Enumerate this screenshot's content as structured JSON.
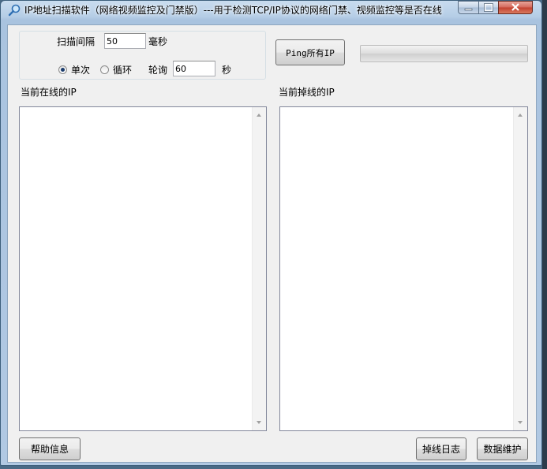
{
  "window": {
    "title": "IP地址扫描软件（网络视频监控及门禁版）---用于检测TCP/IP协议的网络门禁、视频监控等是否在线",
    "icon": "magnifier-icon"
  },
  "settings": {
    "scan_interval_label": "扫描间隔",
    "scan_interval_value": "50",
    "scan_interval_unit": "毫秒",
    "mode_single_label": "单次",
    "mode_loop_label": "循环",
    "mode_selected": "单次",
    "poll_label": "轮询",
    "poll_value": "60",
    "poll_unit": "秒"
  },
  "toolbar": {
    "ping_all_label": "Ping所有IP",
    "progress": 0
  },
  "online": {
    "label": "当前在线的IP",
    "items": []
  },
  "offline": {
    "label": "当前掉线的IP",
    "items": []
  },
  "footer": {
    "help_label": "帮助信息",
    "offline_log_label": "掉线日志",
    "data_maintenance_label": "数据维护"
  }
}
